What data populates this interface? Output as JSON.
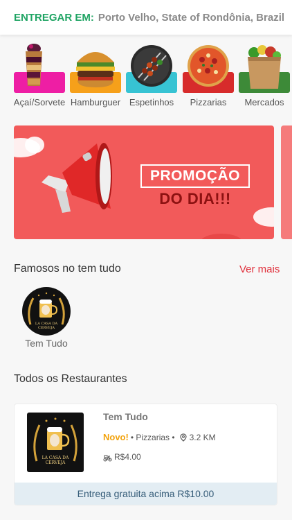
{
  "header": {
    "label": "ENTREGAR EM:",
    "location": "Porto Velho, State of Rondônia, Brazil"
  },
  "categories": [
    {
      "label": "Açaí/Sorvete",
      "color": "#ee1ea4",
      "icon": "acai-cup-icon"
    },
    {
      "label": "Hamburguer",
      "color": "#f6a01a",
      "icon": "burger-icon"
    },
    {
      "label": "Espetinhos",
      "color": "#37c3d3",
      "icon": "skewer-icon"
    },
    {
      "label": "Pizzarias",
      "color": "#d72b2b",
      "icon": "pizza-icon"
    },
    {
      "label": "Mercados",
      "color": "#3d8a38",
      "icon": "grocery-bag-icon"
    }
  ],
  "banner": {
    "title": "PROMOÇÃO",
    "subtitle": "DO DIA!!!"
  },
  "famous": {
    "title": "Famosos no tem tudo",
    "see_more": "Ver mais",
    "items": [
      {
        "name": "Tem Tudo",
        "logo_text": "LA CASA DA CERVEJA"
      }
    ]
  },
  "all_restaurants": {
    "title": "Todos os Restaurantes",
    "items": [
      {
        "name": "Tem Tudo",
        "badge": "Novo!",
        "category": "• Pizzarias •",
        "distance": "3.2 KM",
        "fee": "R$4.00",
        "footer": "Entrega gratuita acima R$10.00",
        "logo_text": "LA CASA DA CERVEJA"
      }
    ]
  }
}
